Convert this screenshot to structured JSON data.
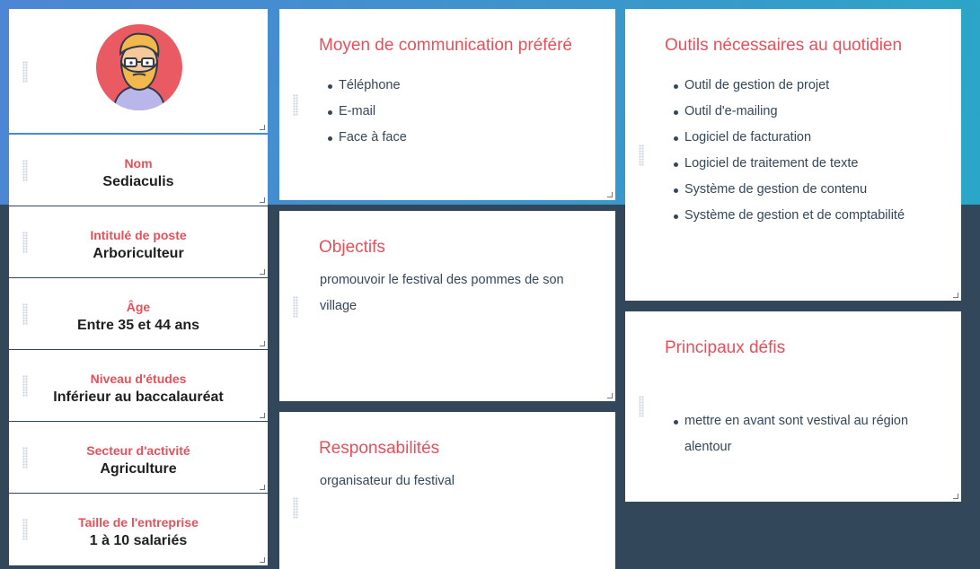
{
  "avatar": {
    "icon": "bearded-man-avatar-icon",
    "accent": "#e5505b"
  },
  "fields": [
    {
      "label": "Nom",
      "value": "Sediaculis"
    },
    {
      "label": "Intitulé de poste",
      "value": "Arboriculteur"
    },
    {
      "label": "Âge",
      "value": "Entre 35 et 44 ans"
    },
    {
      "label": "Niveau d'études",
      "value": "Inférieur au baccalauréat"
    },
    {
      "label": "Secteur d'activité",
      "value": "Agriculture"
    },
    {
      "label": "Taille de l'entreprise",
      "value": "1 à 10 salariés"
    }
  ],
  "communication": {
    "title": "Moyen de communication préféré",
    "items": [
      "Téléphone",
      "E-mail",
      "Face à face"
    ]
  },
  "objectives": {
    "title": "Objectifs",
    "text": "promouvoir le festival des pommes de son village"
  },
  "responsibilities": {
    "title": "Responsabilités",
    "text": "organisateur du festival"
  },
  "tools": {
    "title": "Outils nécessaires au quotidien",
    "items": [
      "Outil de gestion de projet",
      "Outil d'e-mailing",
      "Logiciel de facturation",
      "Logiciel de traitement de texte",
      "Système de gestion de contenu",
      "Système de gestion et de comptabilité"
    ]
  },
  "challenges": {
    "title": "Principaux défis",
    "items": [
      "mettre en avant sont vestival au région alentour"
    ]
  },
  "colors": {
    "accent": "#e5505b",
    "text": "#33475b",
    "background": "#33475b"
  }
}
